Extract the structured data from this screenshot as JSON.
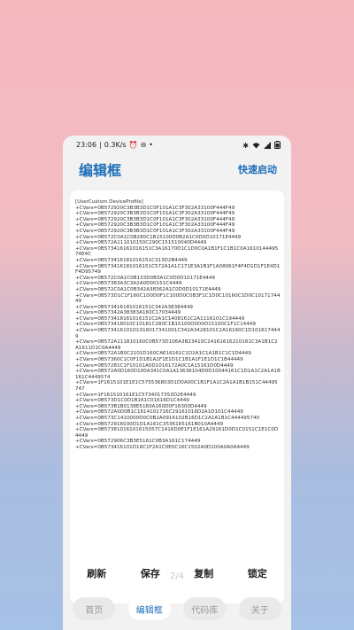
{
  "status": {
    "time": "23:06",
    "speed": "0.3K/s",
    "icons": [
      "alarm-icon",
      "do-not-disturb-icon"
    ],
    "right_icons": [
      "bluetooth-icon",
      "wifi-icon",
      "battery-icon"
    ]
  },
  "header": {
    "title": "编辑框",
    "action": "快速启动"
  },
  "editor": {
    "content": "[UserCustom DeviceProfile]\n+CVars=0B572920C3B3B3D1C0F101A1C3F302A33100F444F49\n+CVars=0B572920C3B3B3D1C0F101A1C3F302A33100F444F49\n+CVars=0B572920C3B3B3D1C0F101A1C3F302A33100F444F49\n+CVars=0B572920C3B3B3D1C0F101A1C3F302A33100F444F49\n+CVars=0B572920C3B3B3D1C0F101A1C3F302A33100F444F49\n+CVars=0B572C0A1C0B280C1B15100D0B2A1C0D0D10171E4449\n+CVars=0B572A111010150C290C151510040D4449\n+CVars=0B573416161016151C3A16170D1C1D0C0A1B1F1C1B1C0A161014449574E4C\n+CVars=0B573416181016151C313D2B4449\n+CVars=0B573416181016151C572A1A1C171E3A1B1F1A08061F4F4D1D1F1E4D1F4D95749\n+CVars=0B572C0A1C0B133D0B3A1C0D0D10171E4449\n+CVars=0B57383A3C3A2A0D00151C4449\n+CVars=0B572C0A1C0B342A38362A1C0D0D10171E4449\n+CVars=0B573D1C1F160C1D0D0F1C100D0C0B3F1C1D0C10160C1D0C1017174449\n+CVars=0B573416181016151C342A38384449\n+CVars=0B57342A38383A160C17034449\n+CVars=0B573418161016151C2A1C1408161C2A1116101C194449\n+CVars=0B573418010C10181C280C1B15100D0D0D15100C1F1C14449\n+CVars=0B573416101D1016017341001C342A3428101C2A16160C1D1016174449\n+CVars=0B572A111810160C0B573D106A3B23410C24161616210161C3A1B1C2A1611D1C0A4449\n+CVars=0B572A1B0C2101D160CAE16161C1D2A1C1A1B1C1C1D4449\n+CVars=0B57360C1C0F1D1B1A1F1E1D1C1B1A1F1E1D1C1B44449\n+CVars=0B57281C1F10101A0D1016172A0C1A15161D0D4449\n+CVars=0B572A0D160D100A341C0A1A13636104D0D10044161C1D1A1C2A1A1B161C4449574\n+CVars=1F1615101E1E1C575536803D1D0A00C1B1F1A1C2A1A1B1B151C44495747\n+CVars=1F161510161E1C5734017353D2E4449\n+CVars=0B573D1C0D1B161C01616D1C4449\n+CVars=0B573B1B0138E5160A160D0F16300D4449\n+CVars=0B572A0D0B1C1614101716C29161016D2A1D101C44449\n+CVars=0B573C1410000D0C0B2A0916102B16D1C2A1A1B1C444495740\n+CVars=0B572916030D1D1A161C3536165161B010A4449\n+CVars=0B57381016101615057C1416D0E1F1E161A29161D0D1C0151C1E1C0D4449\n+CVars=0B572906C3B3E5161C0B3A161C174449\n+CVars=0B573416101D16C1F2A1C0E0C16C1502A0D100A0A0A4449"
  },
  "actions": {
    "refresh": "刷新",
    "save": "保存",
    "copy": "复制",
    "lock": "锁定"
  },
  "pager": {
    "indicator": "2/4"
  },
  "nav": {
    "home": "首页",
    "editor": "编辑框",
    "library": "代码库",
    "about": "关于"
  }
}
